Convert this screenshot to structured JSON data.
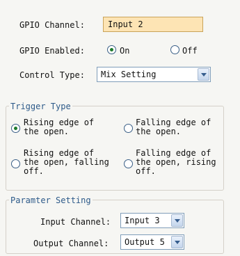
{
  "gpio_channel": {
    "label": "GPIO Channel:",
    "value": "Input 2"
  },
  "gpio_enabled": {
    "label": "GPIO Enabled:",
    "on_label": "On",
    "off_label": "Off",
    "selected": "On"
  },
  "control_type": {
    "label": "Control Type:",
    "value": "Mix Setting"
  },
  "trigger_type": {
    "title": "Trigger Type",
    "options": [
      {
        "label": "Rising edge of\nthe open.",
        "checked": true
      },
      {
        "label": "Falling edge of\nthe open.",
        "checked": false
      },
      {
        "label": "Rising edge of\nthe open, falling\noff.",
        "checked": false
      },
      {
        "label": "Falling edge of\nthe open, rising\noff.",
        "checked": false
      }
    ]
  },
  "parameter_setting": {
    "title": "Paramter Setting",
    "input_channel": {
      "label": "Input Channel:",
      "value": "Input 3"
    },
    "output_channel": {
      "label": "Output Channel:",
      "value": "Output 5"
    }
  }
}
